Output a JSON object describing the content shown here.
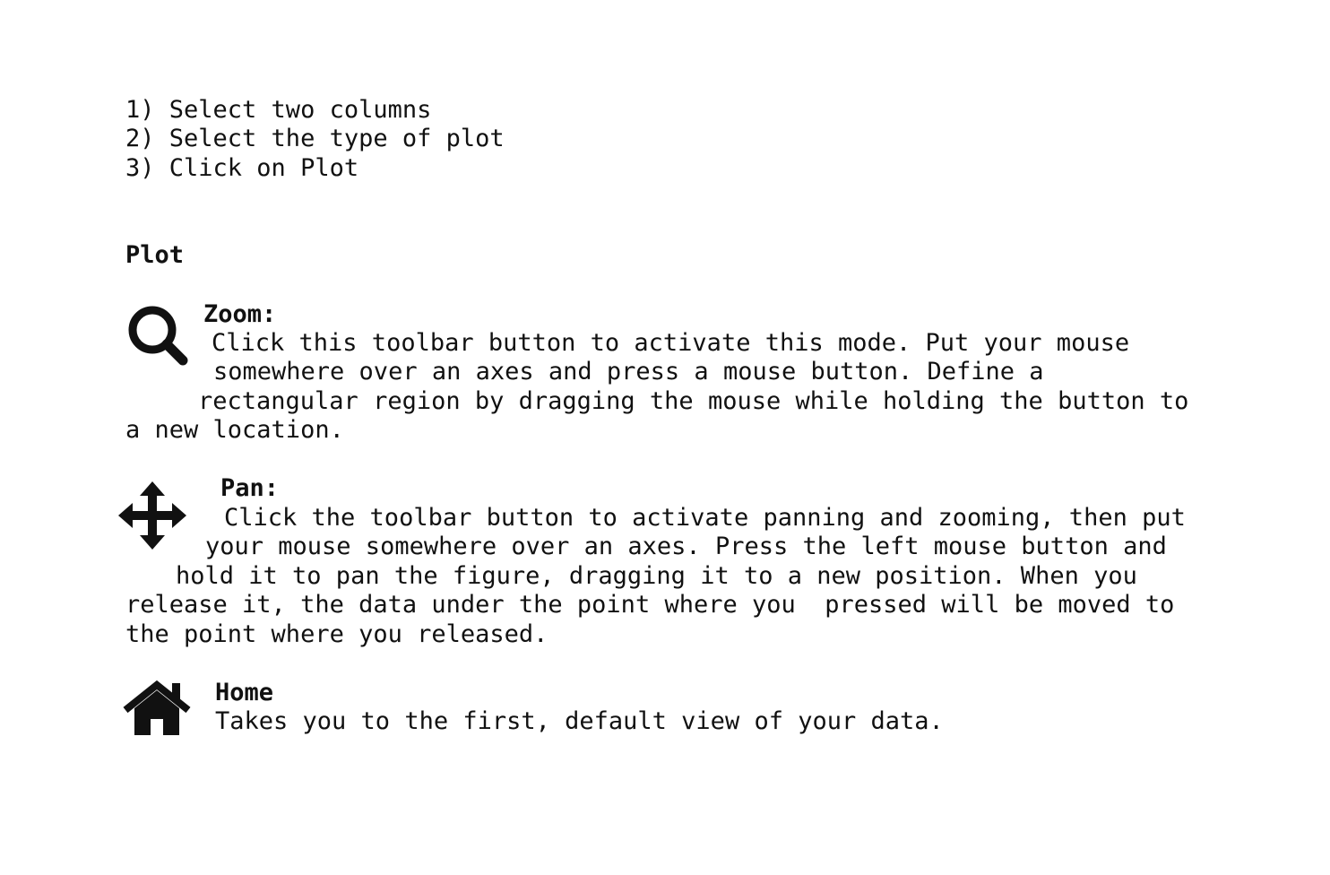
{
  "steps": [
    "1) Select two columns",
    "2) Select the type of plot",
    "3) Click on Plot"
  ],
  "section_title": "Plot",
  "tools": {
    "zoom": {
      "icon": "magnifier-icon",
      "title": "Zoom:",
      "lines": [
        "Click this toolbar button to activate this mode. Put your mouse",
        "somewhere over an axes and press a mouse button. Define a",
        "rectangular region by dragging the mouse while holding the button to",
        "a new location."
      ]
    },
    "pan": {
      "icon": "move-arrows-icon",
      "title": "Pan:",
      "lines": [
        "Click the toolbar button to activate panning and zooming, then put",
        "your mouse somewhere over an axes. Press the left mouse button and",
        "hold it to pan the figure, dragging it to a new position. When you",
        "release it, the data under the point where you  pressed will be moved to",
        "the point where you released."
      ]
    },
    "home": {
      "icon": "home-icon",
      "title": "Home",
      "lines": [
        "Takes you to the first, default view of your data."
      ]
    }
  }
}
